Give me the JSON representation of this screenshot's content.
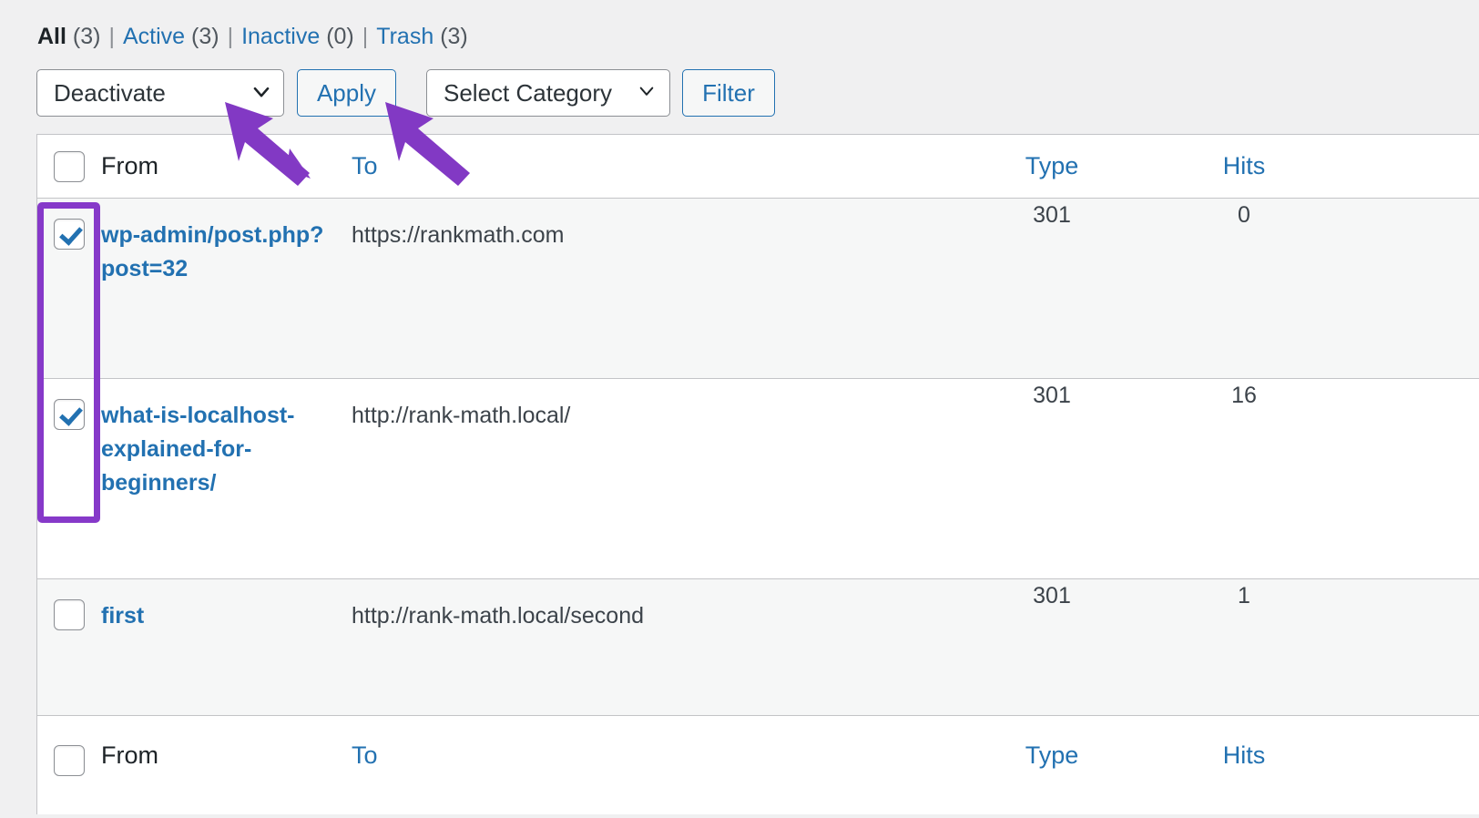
{
  "status_links": [
    {
      "name": "All",
      "count": "(3)",
      "current": true
    },
    {
      "name": "Active",
      "count": "(3)",
      "current": false
    },
    {
      "name": "Inactive",
      "count": "(0)",
      "current": false
    },
    {
      "name": "Trash",
      "count": "(3)",
      "current": false
    }
  ],
  "separator": "|",
  "toolbar": {
    "bulk_action_selected": "Deactivate",
    "apply_label": "Apply",
    "category_selected": "Select Category",
    "filter_label": "Filter"
  },
  "table": {
    "columns": {
      "from": "From",
      "to": "To",
      "type": "Type",
      "hits": "Hits"
    },
    "rows": [
      {
        "checked": true,
        "from": "wp-admin/post.php?post=32",
        "to": "https://rankmath.com",
        "type": "301",
        "hits": "0",
        "shaded": true
      },
      {
        "checked": true,
        "from": "what-is-localhost-explained-for-beginners/",
        "to": "http://rank-math.local/",
        "type": "301",
        "hits": "16",
        "shaded": false
      },
      {
        "checked": false,
        "from": "first",
        "to": "http://rank-math.local/second",
        "type": "301",
        "hits": "1",
        "shaded": true
      }
    ]
  },
  "annotations": {
    "highlight_color": "#8639c9",
    "arrow_color": "#8239c4",
    "arrow_targets": [
      "bulk-action-select",
      "apply-button"
    ],
    "highlight_target": "row-checkbox-column"
  },
  "colors": {
    "link": "#2271b1",
    "text": "#3c434a",
    "page_background": "#f0f0f1",
    "row_shaded": "#f6f7f7",
    "border": "#c3c4c7"
  }
}
